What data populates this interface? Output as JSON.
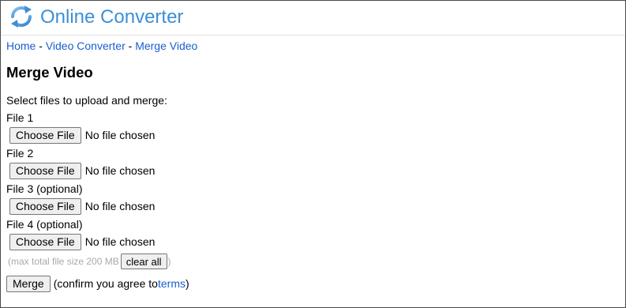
{
  "header": {
    "title": "Online Converter",
    "logo_icon": "refresh-arrows-icon"
  },
  "breadcrumb": {
    "items": [
      "Home",
      "Video Converter",
      "Merge Video"
    ],
    "separator": "-"
  },
  "page": {
    "title": "Merge Video",
    "instruction": "Select files to upload and merge:"
  },
  "files": [
    {
      "label": "File 1",
      "button": "Choose File",
      "status": "No file chosen"
    },
    {
      "label": "File 2",
      "button": "Choose File",
      "status": "No file chosen"
    },
    {
      "label": "File 3 (optional)",
      "button": "Choose File",
      "status": "No file chosen"
    },
    {
      "label": "File 4 (optional)",
      "button": "Choose File",
      "status": "No file chosen"
    }
  ],
  "size_note": {
    "prefix": "(max total file size 200 MB",
    "clear_button": "clear all",
    "suffix": ")"
  },
  "merge": {
    "button": "Merge",
    "confirm_prefix": "(confirm you agree to ",
    "terms_link": "terms",
    "confirm_suffix": ")"
  },
  "colors": {
    "brand": "#3d8fd6",
    "link": "#1a5fd0",
    "muted": "#a9a9a9"
  }
}
